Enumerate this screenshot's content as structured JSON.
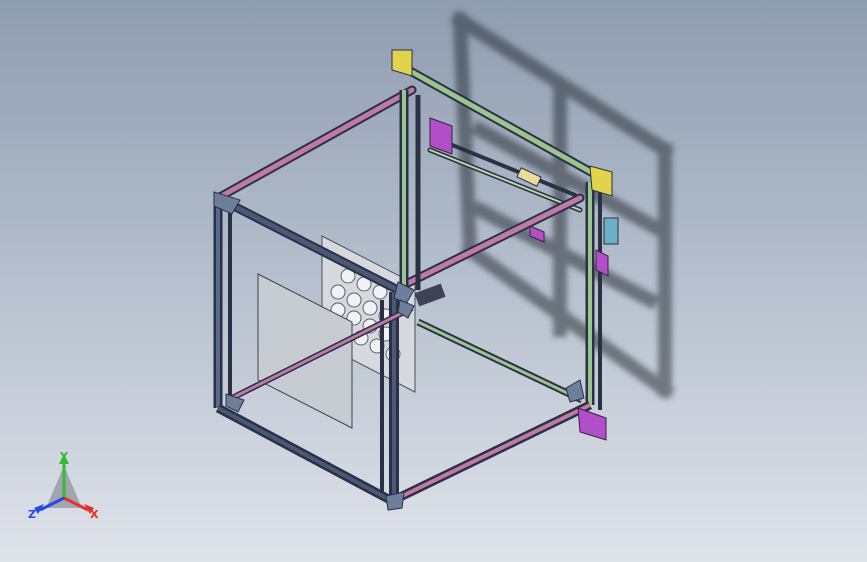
{
  "window": {
    "type": "3d-cad-viewport",
    "background_colors": [
      "#8f9db0",
      "#b2bccb",
      "#dfe3ea"
    ]
  },
  "model": {
    "subject": "cube-frame-3d-printer-assembly",
    "colors": {
      "frame_extrusion": "#4b5876",
      "frame_edge": "#2a3145",
      "rail_pink": "#c07aa6",
      "rail_green": "#9bc48e",
      "motor_purple": "#b14fc8",
      "corner_bracket": "#6e7f9c",
      "plate": "#c9ccd3",
      "yellow_bracket": "#e1d44c",
      "shadow": "#3a3f48"
    },
    "components": [
      "frame",
      "top-rails",
      "gantry",
      "stepper-motors",
      "build-plate",
      "spool-holder",
      "corner-brackets"
    ]
  },
  "triad": {
    "x_label": "X",
    "y_label": "Y",
    "z_label": "Z",
    "x_color": "#e5302a",
    "y_color": "#2fbf2f",
    "z_color": "#2748e6"
  }
}
